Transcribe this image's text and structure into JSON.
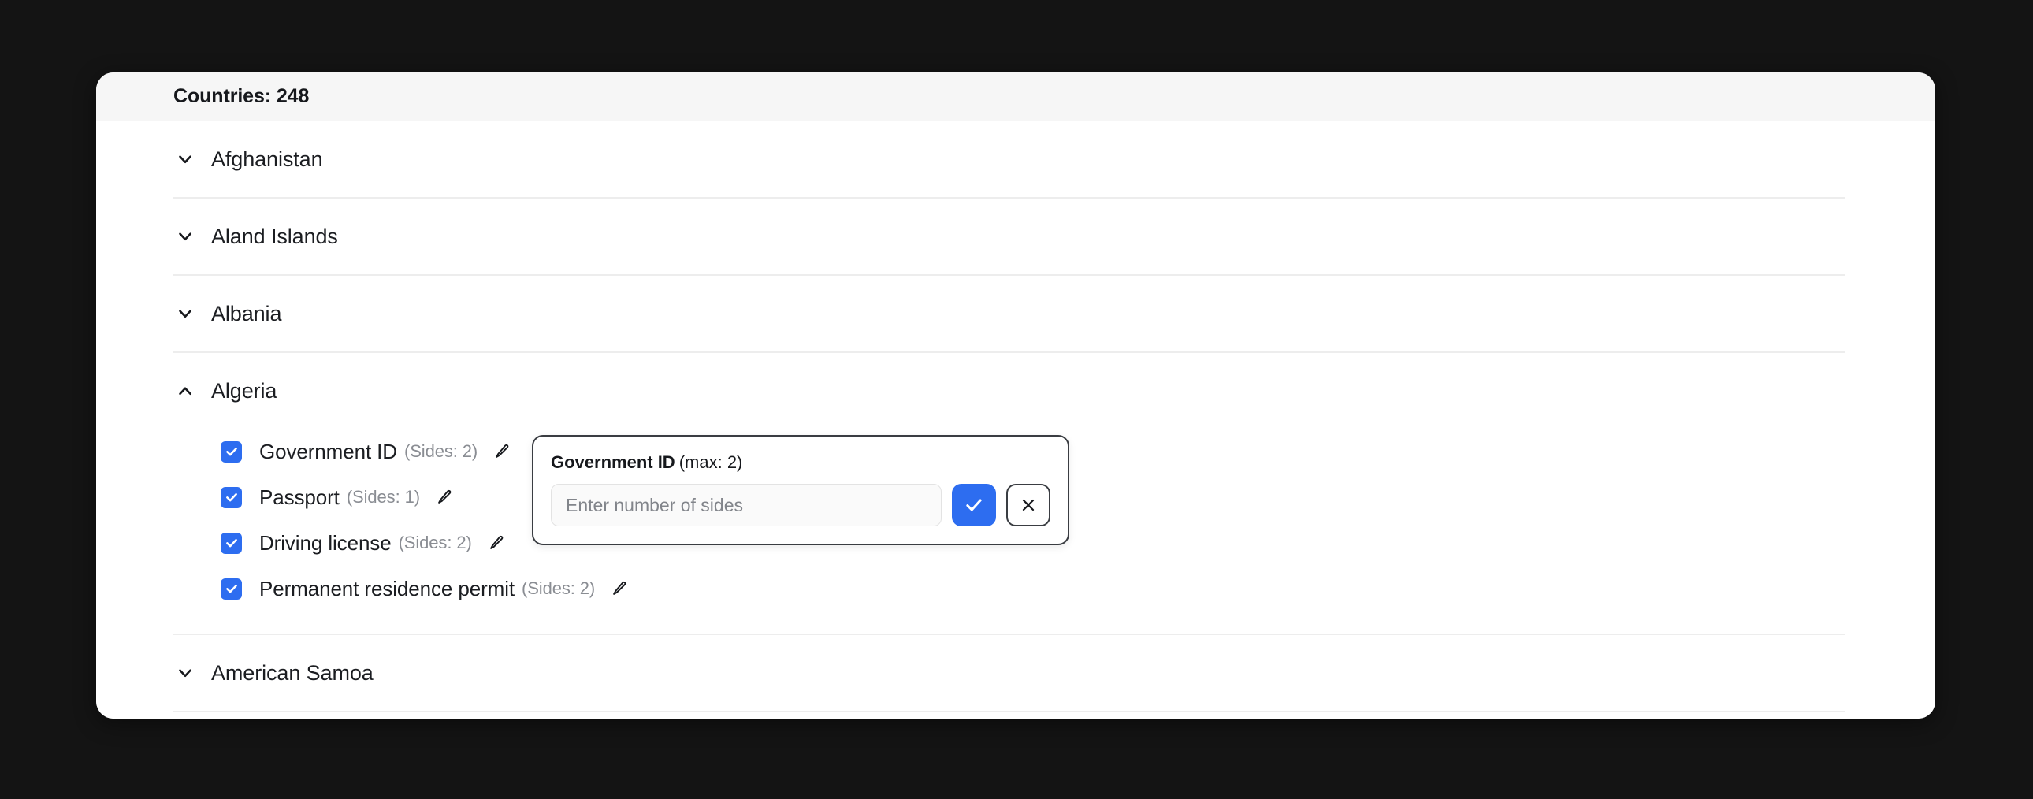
{
  "header": {
    "title": "Countries: 248"
  },
  "countries": [
    {
      "name": "Afghanistan",
      "expanded": false,
      "chevron_icon": "chevron-down-icon"
    },
    {
      "name": "Aland Islands",
      "expanded": false,
      "chevron_icon": "chevron-down-icon"
    },
    {
      "name": "Albania",
      "expanded": false,
      "chevron_icon": "chevron-down-icon"
    },
    {
      "name": "Algeria",
      "expanded": true,
      "chevron_icon": "chevron-up-icon",
      "documents": [
        {
          "label": "Government ID",
          "sides_text": "(Sides: 2)",
          "checked": true,
          "edit_icon": "pencil-icon"
        },
        {
          "label": "Passport",
          "sides_text": "(Sides: 1)",
          "checked": true,
          "edit_icon": "pencil-icon"
        },
        {
          "label": "Driving license",
          "sides_text": "(Sides: 2)",
          "checked": true,
          "edit_icon": "pencil-icon"
        },
        {
          "label": "Permanent residence permit",
          "sides_text": "(Sides: 2)",
          "checked": true,
          "edit_icon": "pencil-icon"
        }
      ]
    },
    {
      "name": "American Samoa",
      "expanded": false,
      "chevron_icon": "chevron-down-icon"
    }
  ],
  "popup": {
    "title_strong": "Government ID",
    "title_max": "(max: 2)",
    "input_value": "",
    "input_placeholder": "Enter number of sides",
    "confirm_icon": "check-icon",
    "cancel_icon": "close-icon"
  },
  "colors": {
    "accent_blue": "#2d6df0",
    "backdrop": "#141414",
    "card_bg": "#ffffff",
    "header_bg": "#f6f6f6",
    "divider": "#ededed",
    "text_primary": "#1b1d21",
    "text_muted": "#8a8d93",
    "popup_border": "#3a3d42"
  }
}
